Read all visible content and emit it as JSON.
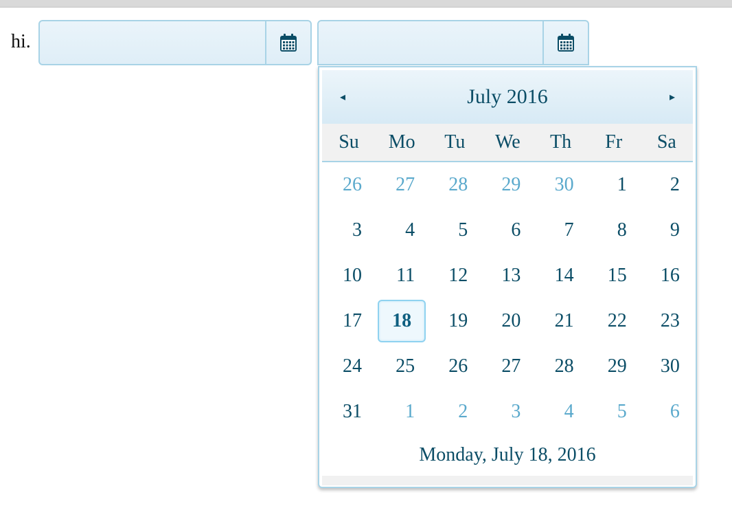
{
  "page": {
    "label": "hi."
  },
  "picker1": {
    "value": "",
    "icon": "calendar-icon"
  },
  "picker2": {
    "value": "",
    "icon": "calendar-icon"
  },
  "calendar": {
    "month_title": "July 2016",
    "prev_icon": "◂",
    "next_icon": "▸",
    "weekdays": [
      "Su",
      "Mo",
      "Tu",
      "We",
      "Th",
      "Fr",
      "Sa"
    ],
    "weeks": [
      [
        "26",
        "27",
        "28",
        "29",
        "30",
        "1",
        "2"
      ],
      [
        "3",
        "4",
        "5",
        "6",
        "7",
        "8",
        "9"
      ],
      [
        "10",
        "11",
        "12",
        "13",
        "14",
        "15",
        "16"
      ],
      [
        "17",
        "18",
        "19",
        "20",
        "21",
        "22",
        "23"
      ],
      [
        "24",
        "25",
        "26",
        "27",
        "28",
        "29",
        "30"
      ],
      [
        "31",
        "1",
        "2",
        "3",
        "4",
        "5",
        "6"
      ]
    ],
    "selected_day": "18",
    "footer": "Monday, July 18, 2016"
  },
  "colors": {
    "text": "#0b4d66",
    "other_month": "#5aa9cc",
    "border": "#a8d3e6",
    "selected_border": "#8fd2f0"
  }
}
